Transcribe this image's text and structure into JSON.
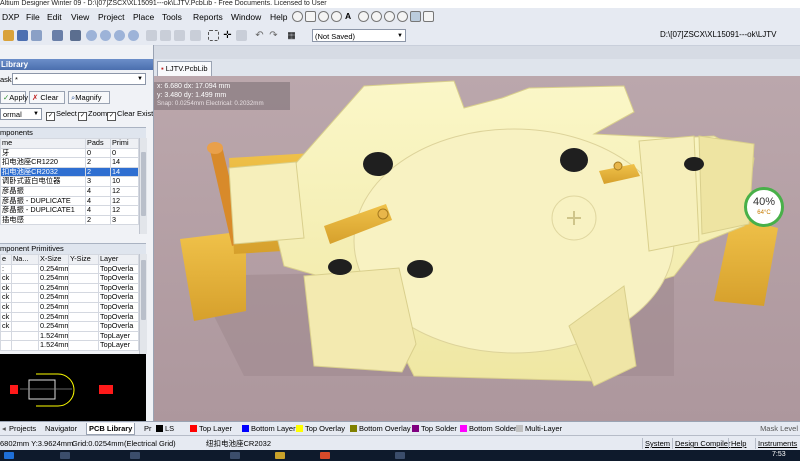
{
  "window": {
    "title": "Altium Designer Winter 09 - D:\\[07]ZSCX\\XL15091---ok\\LJTV.PcbLib - Free Documents. Licensed to User"
  },
  "menu": {
    "items": [
      "DXP",
      "File",
      "Edit",
      "View",
      "Project",
      "Place",
      "Tools",
      "Reports",
      "Window",
      "Help"
    ]
  },
  "toolbar": {
    "saved_state": "(Not Saved)",
    "right_path": "D:\\[07]ZSCX\\XL15091---ok\\LJTV"
  },
  "library_panel": {
    "title": "Library",
    "mask_label": "ask",
    "mask_value": "*",
    "apply_label": "Apply",
    "clear_label": "Clear",
    "magnify_label": "Magnify",
    "mode_value": "ormal",
    "select_label": "Select",
    "zoom_label": "Zoom",
    "clear_existing_label": "Clear Existing",
    "components_header": "mponents",
    "components_columns": [
      "me",
      "Pads",
      "Primi"
    ],
    "components": [
      [
        "牙",
        "0",
        "0"
      ],
      [
        "扣电池座CR1220",
        "2",
        "14"
      ],
      [
        "扣电池座CR2032",
        "2",
        "14"
      ],
      [
        "调卧式蓝白电位器",
        "3",
        "10"
      ],
      [
        "彦晶振",
        "4",
        "12"
      ],
      [
        "彦晶振 - DUPLICATE",
        "4",
        "12"
      ],
      [
        "彦晶振 - DUPLICATE1",
        "4",
        "12"
      ],
      [
        "插电感",
        "2",
        "3"
      ]
    ],
    "selected_component_index": 2,
    "primitives_header": "mponent Primitives",
    "primitives_columns": [
      "e",
      "Na...",
      "X-Size",
      "Y-Size",
      "Layer"
    ],
    "primitives": [
      [
        ":",
        "",
        "0.254mm",
        "",
        "TopOverla"
      ],
      [
        "ck",
        "",
        "0.254mm",
        "",
        "TopOverla"
      ],
      [
        "ck",
        "",
        "0.254mm",
        "",
        "TopOverla"
      ],
      [
        "ck",
        "",
        "0.254mm",
        "",
        "TopOverla"
      ],
      [
        "ck",
        "",
        "0.254mm",
        "",
        "TopOverla"
      ],
      [
        "ck",
        "",
        "0.254mm",
        "",
        "TopOverla"
      ],
      [
        "ck",
        "",
        "0.254mm",
        "",
        "TopOverla"
      ],
      [
        "",
        "",
        "1.524mm",
        "",
        "TopLayer"
      ],
      [
        "",
        "",
        "1.524mm",
        "",
        "TopLayer"
      ]
    ]
  },
  "panel_tabs": [
    "Projects",
    "Navigator",
    "PCB Library",
    "Pr"
  ],
  "document_tab": "LJTV.PcbLib",
  "hud": {
    "line1": "x: 6.680  dx: 17.094 mm",
    "line2": "y: 3.480  dy: 1.499 mm",
    "line3": "Snap: 0.0254mm Electrical: 0.2032mm"
  },
  "gauge": {
    "percent": "40%",
    "temp": "64°C",
    "color": "#48b049"
  },
  "layers": [
    {
      "label": "LS",
      "color": "#000000"
    },
    {
      "label": "Top Layer",
      "color": "#ff0000"
    },
    {
      "label": "Bottom Layer",
      "color": "#0000ff"
    },
    {
      "label": "Top Overlay",
      "color": "#ffff00"
    },
    {
      "label": "Bottom Overlay",
      "color": "#808000"
    },
    {
      "label": "Top Solder",
      "color": "#800080"
    },
    {
      "label": "Bottom Solder",
      "color": "#ff00ff"
    },
    {
      "label": "Multi-Layer",
      "color": "#c0c0c0"
    }
  ],
  "mask_level": "Mask Level",
  "status": {
    "coords": "6802mm Y:3.9624mm",
    "grid": "Grid:0.0254mm",
    "grid_type": "(Electrical Grid)",
    "component": "纽扣电池座CR2032",
    "buttons": [
      "System",
      "Design Compiler",
      "Help",
      "Instruments"
    ]
  },
  "taskbar": {
    "clock": "7:53"
  }
}
